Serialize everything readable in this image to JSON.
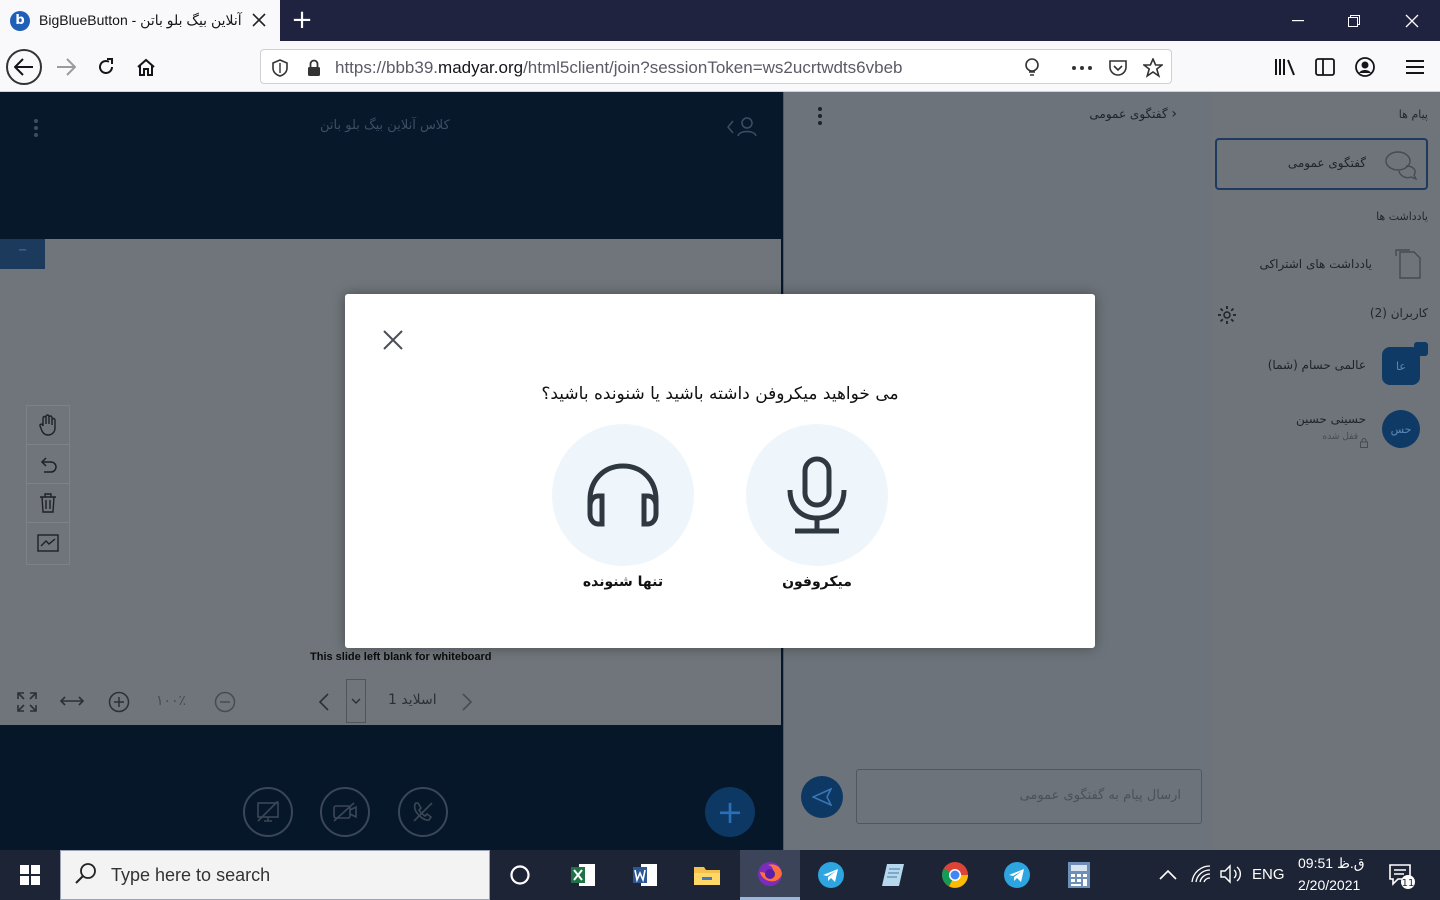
{
  "browser": {
    "tab_title": "BigBlueButton - کلاس آنلاین بیگ بلو باتن",
    "url_prefix": "https://bbb39.",
    "url_domain": "madyar.org",
    "url_path": "/html5client/join?sessionToken=ws2ucrtwdts6vbeb"
  },
  "presentation": {
    "meeting_title": "کلاس آنلاین بیگ بلو باتن",
    "slide_caption": "This slide left blank for whiteboard",
    "zoom_value": "۱۰۰٪",
    "slide_label": "اسلاید 1"
  },
  "chat": {
    "title": "گفتگوی عمومی",
    "input_placeholder": "ارسال پیام به گفتگوی عمومی"
  },
  "user_panel": {
    "messages_section": "پیام ها",
    "public_chat_item": "گفتگوی عمومی",
    "notes_section": "یادداشت ها",
    "shared_notes_item": "یادداشت های اشتراکی",
    "users_section": "کاربران (2)",
    "users": [
      {
        "initials": "عا",
        "name": "عالمی حسام (شما)",
        "status": ""
      },
      {
        "initials": "حس",
        "name": "حسینی حسین",
        "status": "قفل شده"
      }
    ]
  },
  "modal": {
    "question": "می خواهید میکروفن داشته باشید یا شنونده باشید؟",
    "listen_only_label": "تنها شنونده",
    "microphone_label": "میکروفون"
  },
  "taskbar": {
    "search_placeholder": "Type here to search",
    "lang": "ENG",
    "time": "09:51 ق.ظ",
    "date": "2/20/2021"
  }
}
